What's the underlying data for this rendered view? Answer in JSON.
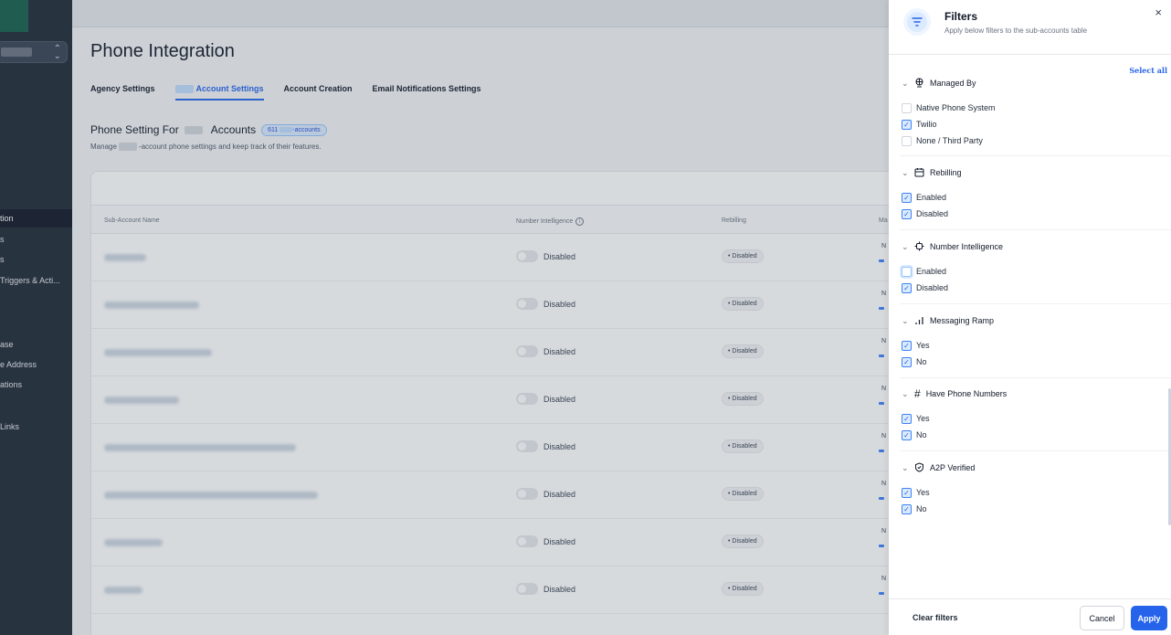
{
  "sidebar": {
    "items": [
      {
        "label": "tion",
        "active": true
      },
      {
        "label": "s",
        "active": false
      },
      {
        "label": "s",
        "active": false
      },
      {
        "label": "Triggers & Acti...",
        "active": false
      },
      {
        "label": "ase",
        "active": false
      },
      {
        "label": "e Address",
        "active": false
      },
      {
        "label": "ations",
        "active": false
      },
      {
        "label": "Links",
        "active": false
      }
    ]
  },
  "page": {
    "title": "Phone Integration",
    "tabs": [
      {
        "label": "Agency Settings"
      },
      {
        "label": "Account Settings"
      },
      {
        "label": "Account Creation"
      },
      {
        "label": "Email Notifications Settings"
      }
    ],
    "section_title_prefix": "Phone Setting For",
    "section_title_suffix": "Accounts",
    "accounts_pill_count": "611",
    "accounts_pill_suffix": "-accounts",
    "section_sub_prefix": "Manage",
    "section_sub_suffix": "-account phone settings and keep track of their features."
  },
  "table": {
    "columns": [
      "Sub-Account Name",
      "Number Intelligence",
      "Rebilling",
      "Ma"
    ],
    "rows": [
      {
        "status": "Disabled",
        "rebilling": "• Disabled",
        "edge": "N"
      },
      {
        "status": "Disabled",
        "rebilling": "• Disabled",
        "edge": "N"
      },
      {
        "status": "Disabled",
        "rebilling": "• Disabled",
        "edge": "N"
      },
      {
        "status": "Disabled",
        "rebilling": "• Disabled",
        "edge": "N"
      },
      {
        "status": "Disabled",
        "rebilling": "• Disabled",
        "edge": "N"
      },
      {
        "status": "Disabled",
        "rebilling": "• Disabled",
        "edge": "N"
      },
      {
        "status": "Disabled",
        "rebilling": "• Disabled",
        "edge": "N"
      },
      {
        "status": "Disabled",
        "rebilling": "• Disabled",
        "edge": "N"
      }
    ]
  },
  "filters": {
    "title": "Filters",
    "subtitle": "Apply below filters to the sub-accounts table",
    "close": "×",
    "select_all": "Select  all",
    "groups": [
      {
        "label": "Managed By",
        "icon": "globe-icon",
        "options": [
          {
            "label": "Native Phone System",
            "checked": false
          },
          {
            "label": "Twilio",
            "checked": true
          },
          {
            "label": "None / Third Party",
            "checked": false
          }
        ]
      },
      {
        "label": "Rebilling",
        "icon": "calendar-icon",
        "options": [
          {
            "label": "Enabled",
            "checked": true
          },
          {
            "label": "Disabled",
            "checked": true
          }
        ]
      },
      {
        "label": "Number Intelligence",
        "icon": "chip-icon",
        "options": [
          {
            "label": "Enabled",
            "checked": false
          },
          {
            "label": "Disabled",
            "checked": true
          }
        ]
      },
      {
        "label": "Messaging Ramp",
        "icon": "signal-bars-icon",
        "options": [
          {
            "label": "Yes",
            "checked": true
          },
          {
            "label": "No",
            "checked": true
          }
        ]
      },
      {
        "label": "Have Phone Numbers",
        "icon": "hash-icon",
        "options": [
          {
            "label": "Yes",
            "checked": true
          },
          {
            "label": "No",
            "checked": true
          }
        ]
      },
      {
        "label": "A2P Verified",
        "icon": "shield-check-icon",
        "options": [
          {
            "label": "Yes",
            "checked": true
          },
          {
            "label": "No",
            "checked": true
          }
        ]
      }
    ],
    "clear_label": "Clear filters",
    "cancel_label": "Cancel",
    "apply_label": "Apply"
  },
  "colors": {
    "accent": "#2563eb",
    "sidebar": "#1f2937"
  }
}
